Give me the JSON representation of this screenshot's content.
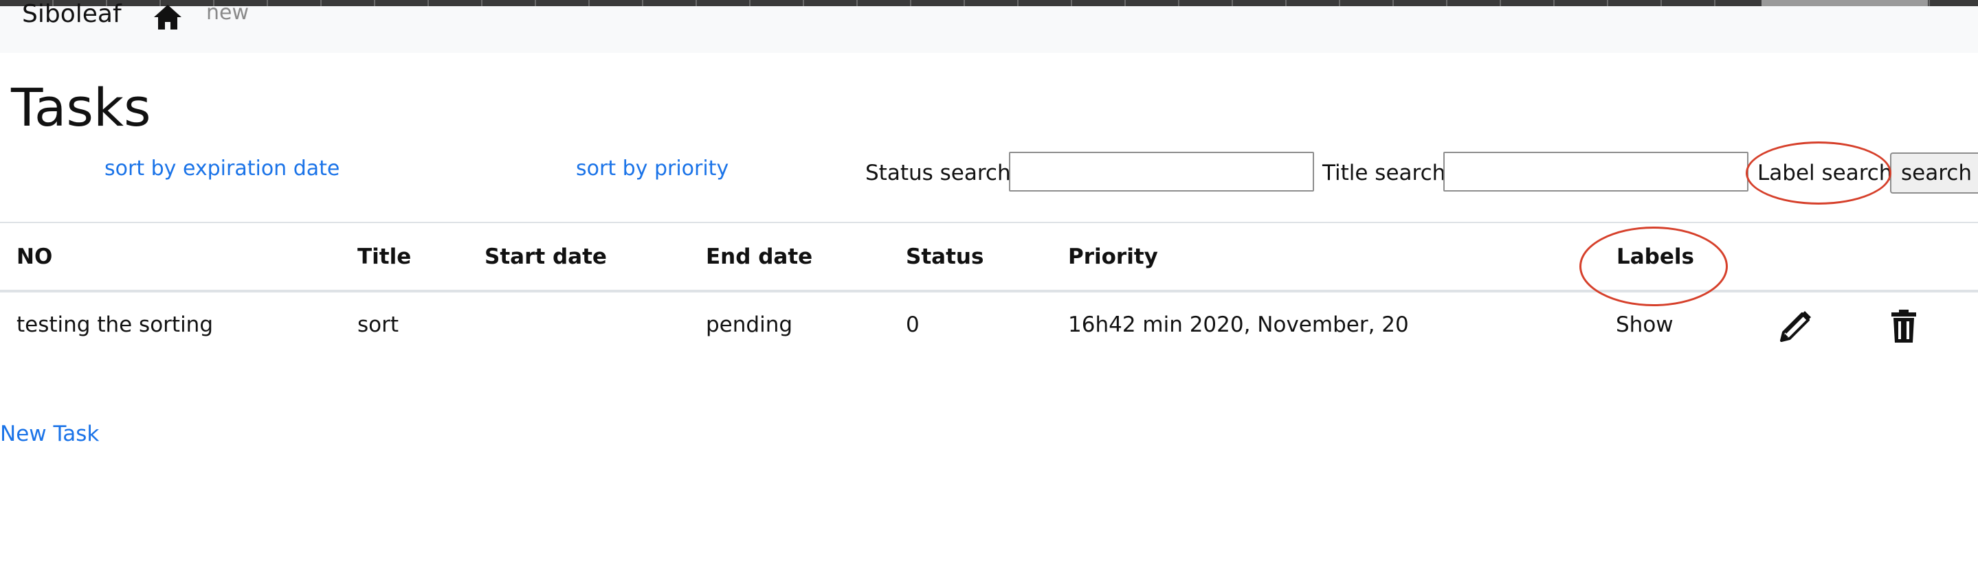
{
  "navbar": {
    "brand": "Siboleaf",
    "home_icon": "home-icon",
    "new_link": "new"
  },
  "page": {
    "title": "Tasks"
  },
  "sort_links": {
    "by_expiration": "sort by expiration date",
    "by_priority": "sort by priority"
  },
  "search": {
    "status_label": "Status search",
    "status_value": "",
    "title_label": "Title search",
    "title_value": "",
    "label_label": "Label search",
    "button": "search"
  },
  "table": {
    "headers": [
      "NO",
      "Title",
      "Start date",
      "End date",
      "Status",
      "Priority",
      "Labels"
    ],
    "rows": [
      {
        "no": "testing the sorting",
        "title": "sort",
        "start_date": "",
        "end_date": "pending",
        "status": "0",
        "priority": "16h42 min 2020, November, 20",
        "labels": "Show",
        "edit_icon": "pencil-icon",
        "delete_icon": "trash-icon"
      }
    ]
  },
  "footer": {
    "new_task": "New Task"
  },
  "annotations": {
    "color": "#d6402b",
    "circled": [
      "Label search",
      "Labels"
    ]
  }
}
